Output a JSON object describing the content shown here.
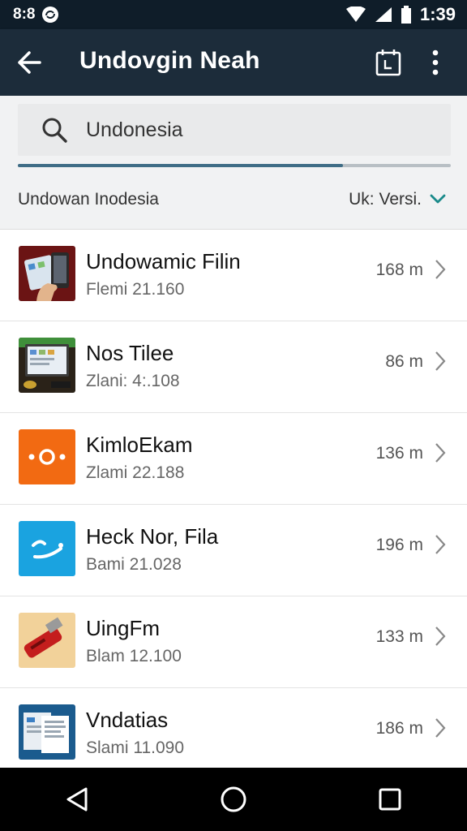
{
  "status_bar": {
    "left_text": "8:8",
    "time": "1:39",
    "icons": [
      "sync-icon",
      "wifi-icon",
      "signal-icon",
      "battery-icon"
    ]
  },
  "app_bar": {
    "title": "Undovgin Neah",
    "back_icon": "arrow-back-icon",
    "calendar_icon": "calendar-icon",
    "more_icon": "more-vert-icon"
  },
  "search": {
    "value": "Undonesia",
    "placeholder": "Undonesia",
    "icon": "search-icon",
    "progress": 0.75
  },
  "filter": {
    "label": "Undowan Inodesia",
    "version_label": "Uk:  Versi.",
    "accent_color": "#1a8a8a"
  },
  "items": [
    {
      "name": "Undowamic Filin",
      "meta": "Flemi 21.160",
      "size": "168 m",
      "icon": "tablet-hand-icon"
    },
    {
      "name": "Nos Tilee",
      "meta": "Zlani: 4:.108",
      "size": "86 m",
      "icon": "desktop-screen-icon"
    },
    {
      "name": "KimloEkam",
      "meta": "Zlami 22.188",
      "size": "136 m",
      "icon": "orange-dots-icon"
    },
    {
      "name": "Heck Nor, Fila",
      "meta": "Bami 21.028",
      "size": "196 m",
      "icon": "blue-wave-icon"
    },
    {
      "name": "UingFm",
      "meta": "Blam 12.100",
      "size": "133 m",
      "icon": "red-usb-icon"
    },
    {
      "name": "Vndatias",
      "meta": "Slami 11.090",
      "size": "186 m",
      "icon": "documents-icon"
    }
  ],
  "nav_bar": {
    "back": "nav-back-icon",
    "home": "nav-home-icon",
    "recents": "nav-recents-icon"
  }
}
